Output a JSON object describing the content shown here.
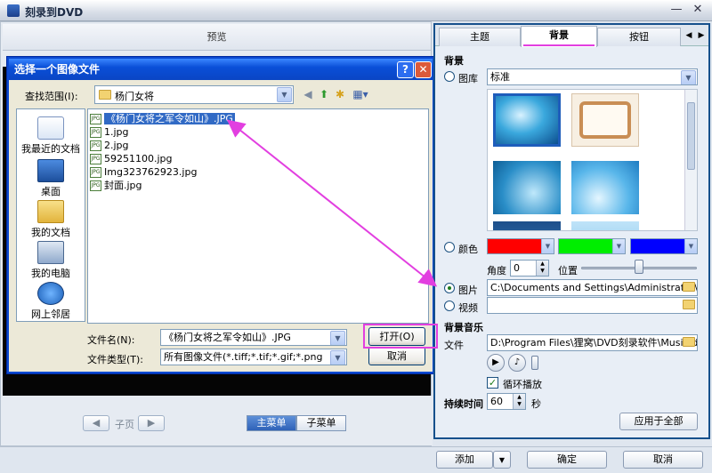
{
  "window": {
    "title": "刻录到DVD",
    "minimize": "—",
    "close": "✕"
  },
  "preview": {
    "header": "预览"
  },
  "nav": {
    "prev": "◀",
    "subpage": "子页",
    "next": "▶",
    "main_menu": "主菜单",
    "sub_menu": "子菜单"
  },
  "dialog": {
    "title": "选择一个图像文件",
    "help": "?",
    "close": "✕",
    "look_in_label": "查找范围(I):",
    "look_in_value": "杨门女将",
    "places": [
      {
        "label": "我最近的文档",
        "icon": "recent-documents-icon"
      },
      {
        "label": "桌面",
        "icon": "desktop-icon"
      },
      {
        "label": "我的文档",
        "icon": "my-documents-icon"
      },
      {
        "label": "我的电脑",
        "icon": "my-computer-icon"
      },
      {
        "label": "网上邻居",
        "icon": "network-places-icon"
      }
    ],
    "files": [
      {
        "name": "《杨门女将之军令如山》.JPG",
        "icon": "jpg-file-icon",
        "selected": true
      },
      {
        "name": "1.jpg",
        "icon": "jpg-file-icon",
        "selected": false
      },
      {
        "name": "2.jpg",
        "icon": "jpg-file-icon",
        "selected": false
      },
      {
        "name": "59251100.jpg",
        "icon": "jpg-file-icon",
        "selected": false
      },
      {
        "name": "Img323762923.jpg",
        "icon": "jpg-file-icon",
        "selected": false
      },
      {
        "name": "封面.jpg",
        "icon": "jpg-file-icon",
        "selected": false
      }
    ],
    "filename_label": "文件名(N):",
    "filename_value": "《杨门女将之军令如山》.JPG",
    "filetype_label": "文件类型(T):",
    "filetype_value": "所有图像文件(*.tiff;*.tif;*.gif;*.png",
    "open_button": "打开(O)",
    "cancel_button": "取消",
    "jpg_icon_text": "JPG"
  },
  "right": {
    "tabs": [
      "主题",
      "背景",
      "按钮"
    ],
    "tab_prev": "◀",
    "tab_next": "▶",
    "bg_section": "背景",
    "gallery_label": "图库",
    "gallery_value": "标准",
    "color_label": "颜色",
    "colors": [
      "#ff0000",
      "#00ee00",
      "#0000ff"
    ],
    "angle_label": "角度",
    "angle_value": "0",
    "position_label": "位置",
    "position_level": 0.5,
    "picture_label": "图片",
    "picture_path": "C:\\Documents and Settings\\Administrator\\桌面",
    "video_label": "视频",
    "video_path": "",
    "music_section": "背景音乐",
    "file_label": "文件",
    "music_path": "D:\\Program Files\\狸窝\\DVD刻录软件\\Music\\defa",
    "loop_label": "循环播放",
    "duration_label": "持续时间",
    "duration_value": "60",
    "duration_unit": "秒",
    "apply_all": "应用于全部"
  },
  "footer": {
    "add": "添加",
    "add_arrow": "▼",
    "ok": "确定",
    "cancel": "取消"
  }
}
